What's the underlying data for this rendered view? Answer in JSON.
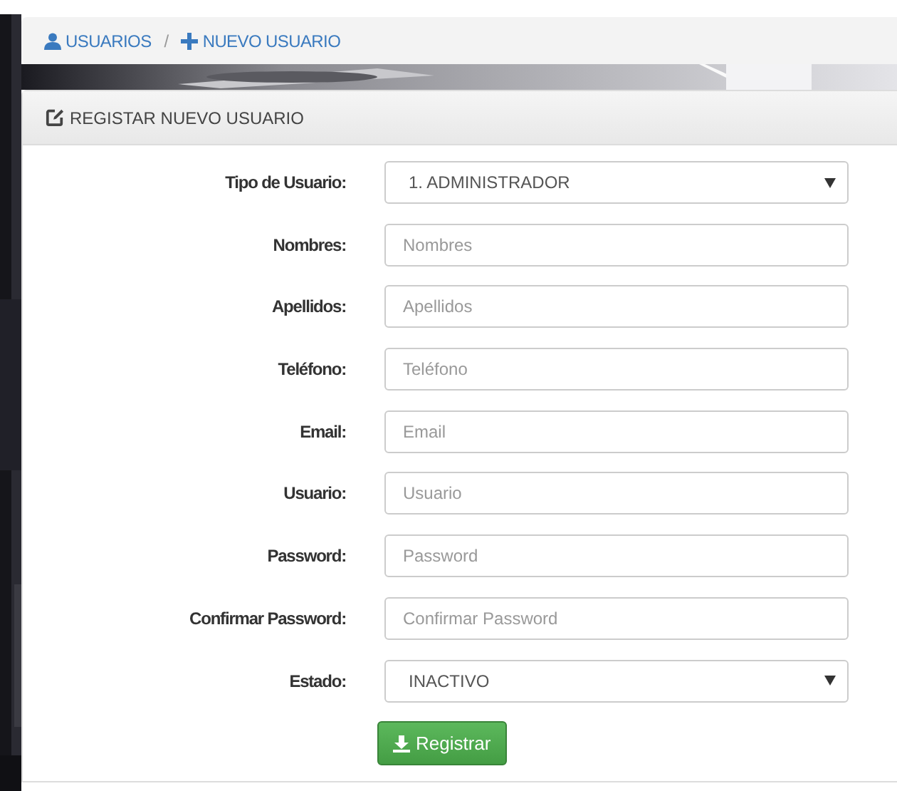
{
  "breadcrumb": [
    {
      "kind": "user",
      "label": "USUARIOS"
    },
    {
      "kind": "plus",
      "label": "NUEVO USUARIO"
    }
  ],
  "breadcrumb_separator": "/",
  "panel": {
    "title": "REGISTAR NUEVO USUARIO"
  },
  "fields": [
    {
      "kind": "select",
      "label": "Tipo de Usuario:",
      "value": "1. ADMINISTRADOR"
    },
    {
      "kind": "input",
      "label": "Nombres:",
      "placeholder": "Nombres"
    },
    {
      "kind": "input",
      "label": "Apellidos:",
      "placeholder": "Apellidos"
    },
    {
      "kind": "input",
      "label": "Teléfono:",
      "placeholder": "Teléfono"
    },
    {
      "kind": "input",
      "label": "Email:",
      "placeholder": "Email"
    },
    {
      "kind": "input",
      "label": "Usuario:",
      "placeholder": "Usuario"
    },
    {
      "kind": "input",
      "label": "Password:",
      "placeholder": "Password"
    },
    {
      "kind": "input",
      "label": "Confirmar Password:",
      "placeholder": "Confirmar Password"
    },
    {
      "kind": "select",
      "label": "Estado:",
      "value": "INACTIVO"
    }
  ],
  "submit": {
    "label": "Registrar"
  }
}
